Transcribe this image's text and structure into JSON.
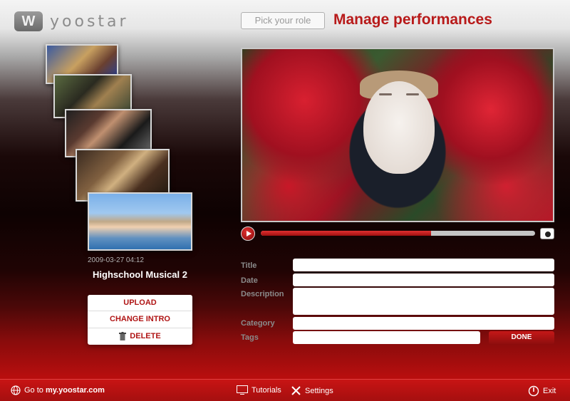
{
  "brand": {
    "logo_text": "yoostar",
    "logo_mark": "W"
  },
  "header": {
    "pick_role": "Pick your role",
    "title": "Manage performances"
  },
  "performance": {
    "date": "2009-03-27 04:12",
    "name": "Highschool Musical 2",
    "thumbnails": [
      "thumbnail-1",
      "thumbnail-2",
      "thumbnail-3",
      "thumbnail-4",
      "thumbnail-5"
    ]
  },
  "actions": {
    "upload": "UPLOAD",
    "change_intro": "CHANGE INTRO",
    "delete": "DELETE"
  },
  "player": {
    "progress": 0.62
  },
  "form": {
    "title_label": "Title",
    "date_label": "Date",
    "description_label": "Description",
    "category_label": "Category",
    "tags_label": "Tags",
    "done": "DONE"
  },
  "footer": {
    "goto_prefix": "Go to",
    "goto_link": "my.yoostar.com",
    "tutorials": "Tutorials",
    "settings": "Settings",
    "exit": "Exit"
  },
  "colors": {
    "accent": "#b81a1a",
    "footer": "#c41414"
  }
}
